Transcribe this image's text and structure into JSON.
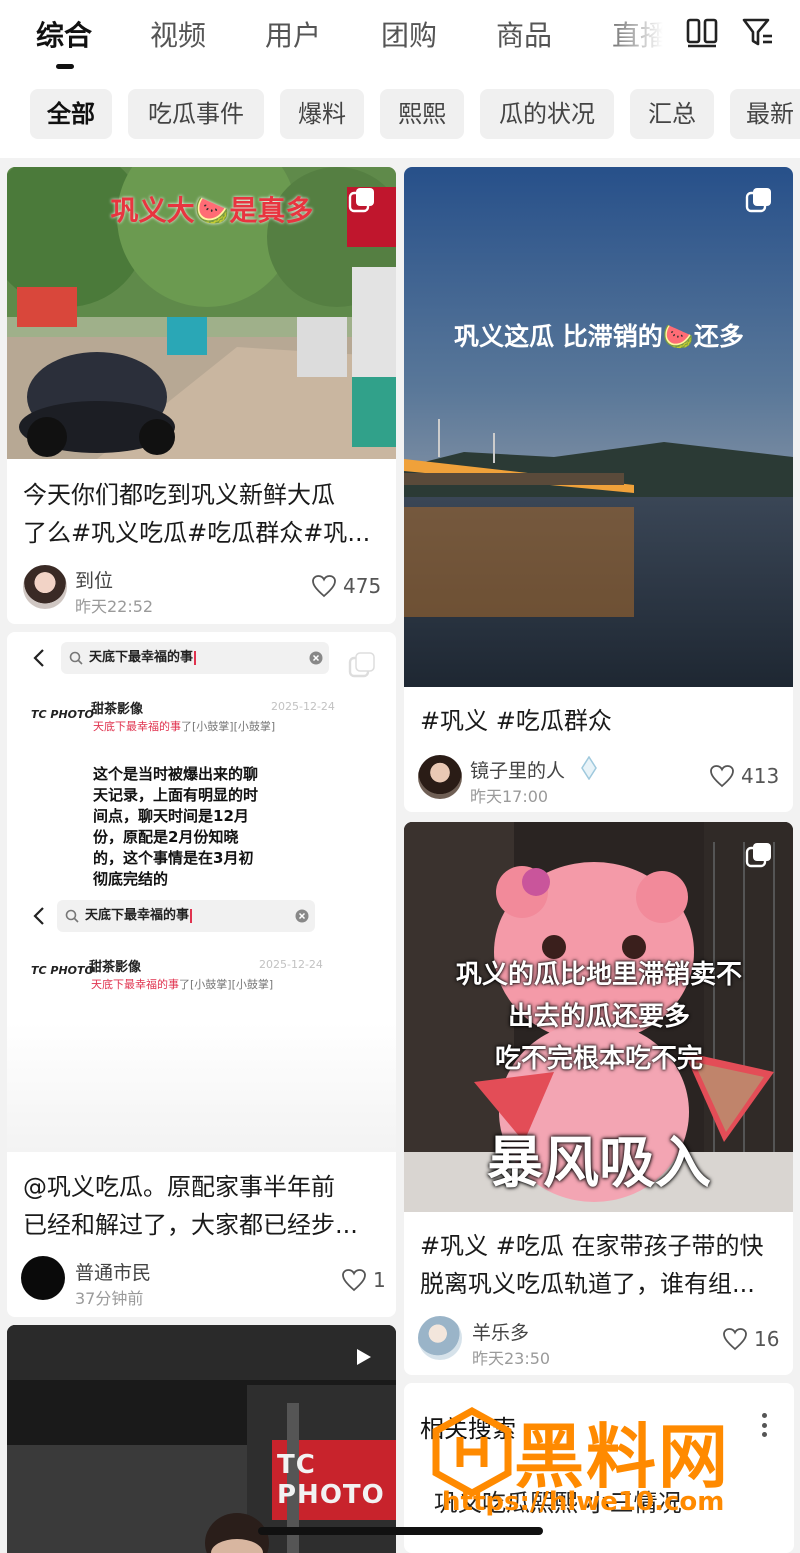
{
  "tabs": [
    "综合",
    "视频",
    "用户",
    "团购",
    "商品",
    "直播"
  ],
  "chips": [
    "全部",
    "吃瓜事件",
    "爆料",
    "熙熙",
    "瓜的状况",
    "汇总",
    "最新"
  ],
  "cards": {
    "c1": {
      "overlay": "巩义大🍉是真多",
      "title_line1": "今天你们都吃到巩义新鲜大瓜",
      "title_line2": "了么#巩义吃瓜#吃瓜群众#巩...",
      "user": "到位",
      "time": "昨天22:52",
      "likes": "475"
    },
    "c2": {
      "overlay": "巩义这瓜 比滞销的🍉还多",
      "title": "#巩义 #吃瓜群众",
      "user": "镜子里的人",
      "time": "昨天17:00",
      "likes": "413"
    },
    "c3": {
      "search_text": "天底下最幸福的事",
      "logo": "TC PHOTO",
      "logo_sub": "甜茶影像",
      "shot_name": "甜茶影像",
      "shot_date": "2025-12-24",
      "snippet_red": "天底下最幸福的事",
      "snippet_rest": "了[小鼓掌][小鼓掌]",
      "body_1": "这个是当时被爆出来的聊",
      "body_2": "天记录，上面有明显的时",
      "body_3": "间点，聊天时间是12月",
      "body_4": "份，原配是2月份知晓",
      "body_5": "的，这个事情是在3月初",
      "body_6": "彻底完结的",
      "title_line1": "@巩义吃瓜。原配家事半年前",
      "title_line2": "已经和解过了，大家都已经步...",
      "user": "普通市民",
      "time": "37分钟前",
      "likes": "1"
    },
    "c4": {
      "overlay_1": "巩义的瓜比地里滞销卖不",
      "overlay_2": "出去的瓜还要多",
      "overlay_3": "吃不完根本吃不完",
      "overlay_big": "暴风吸入",
      "title_line1": "#巩义 #吃瓜 在家带孩子带的快",
      "title_line2": "脱离巩义吃瓜轨道了，谁有组...",
      "user": "羊乐多",
      "time": "昨天23:50",
      "likes": "16"
    },
    "c5": {
      "sign": "TC PHOTO"
    }
  },
  "related": {
    "title": "相关搜索",
    "item": "巩义吃瓜熙熙 小三情况",
    "watermark": "黑料网",
    "watermark_url": "https://hlwe10.com"
  },
  "colors": {
    "accent": "#e0334f",
    "watermark": "#ff8a00"
  },
  "icons": [
    "grid-view-icon",
    "filter-icon",
    "multi-image-icon",
    "play-icon",
    "heart-icon",
    "search-icon",
    "back-arrow-icon",
    "clear-icon"
  ]
}
